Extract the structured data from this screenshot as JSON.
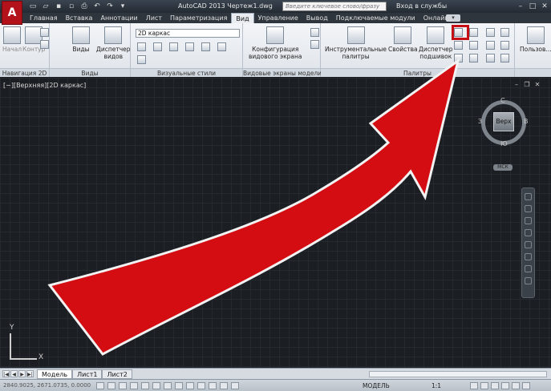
{
  "title_bar": {
    "app_logo": "A",
    "title": "AutoCAD 2013    Чертеж1.dwg",
    "search_placeholder": "Введите ключевое слово/фразу",
    "sign_in": "Вход в службы"
  },
  "tabs": [
    "Главная",
    "Вставка",
    "Аннотации",
    "Лист",
    "Параметризация",
    "Вид",
    "Управление",
    "Вывод",
    "Подключаемые модули",
    "Онлайн"
  ],
  "active_tab": "Вид",
  "ribbon": {
    "panels": {
      "nav2d": {
        "title": "Навигация 2D",
        "pan": "Начал",
        "zoom": "Контур"
      },
      "views": {
        "title": "Виды",
        "views": "Виды",
        "view_manager": "Диспетчер\nвидов"
      },
      "visual_styles": {
        "title": "Визуальные стили",
        "current_style": "2D каркас"
      },
      "viewports": {
        "title": "Видовые экраны модели",
        "config": "Конфигурация\nвидового экрана"
      },
      "palettes": {
        "title": "Палитры",
        "tool_palettes": "Инструментальные\nпалитры",
        "properties": "Свойства",
        "sheet_set": "Диспетчер\nподшивок"
      },
      "user_interface": {
        "title": "",
        "user": "Пользов..."
      }
    }
  },
  "viewport": {
    "label": "[−][Верхняя][2D каркас]",
    "viewcube": {
      "face": "Верх",
      "north": "С",
      "south": "Ю",
      "west": "З",
      "east": "В"
    },
    "wcs": "МСК",
    "ucs": {
      "x": "X",
      "y": "Y"
    }
  },
  "layout_tabs": [
    "Модель",
    "Лист1",
    "Лист2"
  ],
  "active_layout": "Модель",
  "status_bar": {
    "coords": "2840.9025, 2671.0735, 0.0000",
    "model": "МОДЕЛЬ",
    "scale": "1:1"
  },
  "colors": {
    "highlight": "#c40f14",
    "arrow": "#d30d12",
    "viewport_bg": "#1b1e22"
  }
}
